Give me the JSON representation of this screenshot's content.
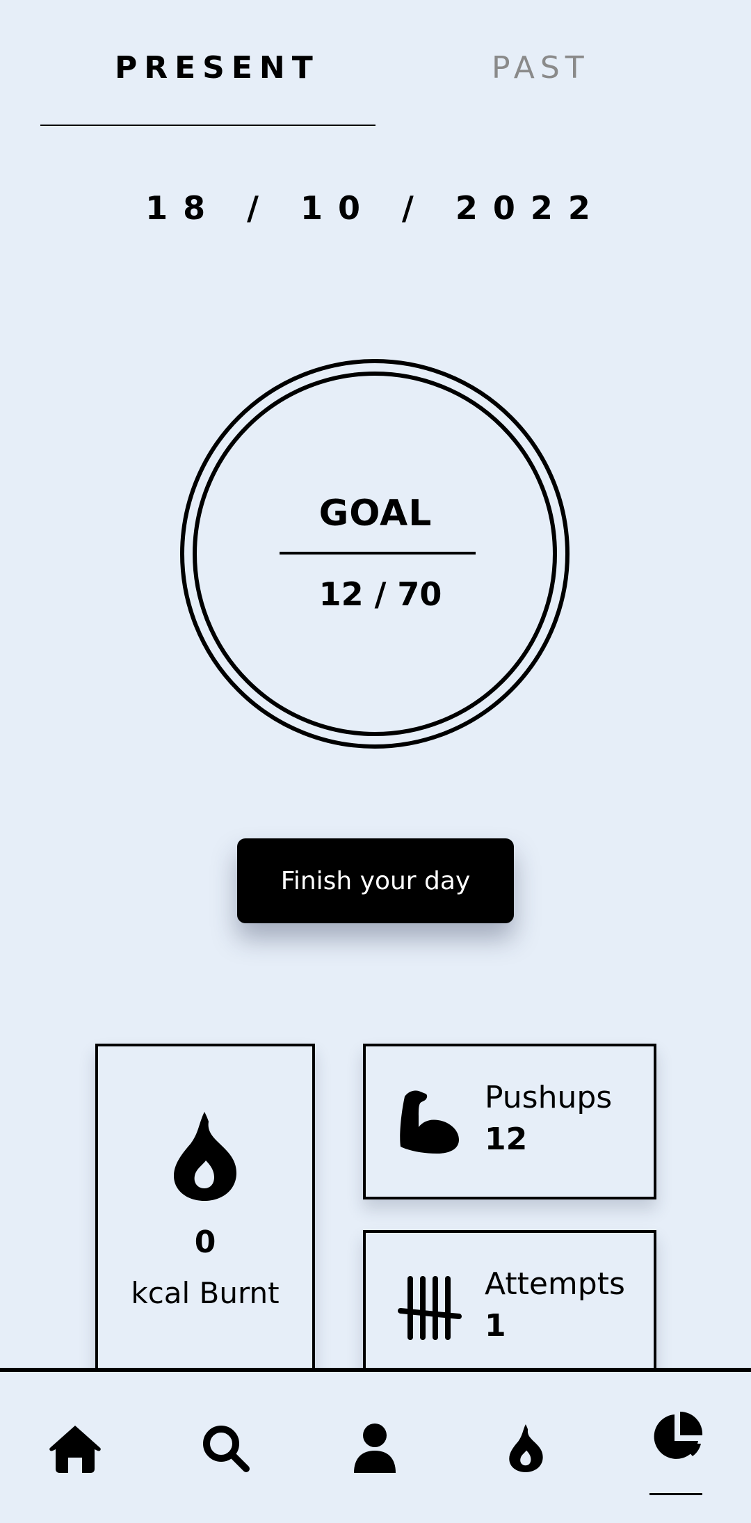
{
  "tabs": {
    "present_label": "PRESENT",
    "past_label": "PAST"
  },
  "date": "18 / 10 / 2022",
  "goal": {
    "title": "GOAL",
    "value": "12 / 70",
    "current": 12,
    "target": 70
  },
  "actions": {
    "finish_label": "Finish your day"
  },
  "stats": {
    "kcal": {
      "value": "0",
      "label": "kcal Burnt",
      "icon": "flame-icon"
    },
    "pushups": {
      "label": "Pushups",
      "value": "12",
      "icon": "flexed-arm-icon"
    },
    "attempts": {
      "label": "Attempts",
      "value": "1",
      "icon": "tally-marks-icon"
    }
  },
  "nav": {
    "items": [
      {
        "icon": "home-icon"
      },
      {
        "icon": "search-icon"
      },
      {
        "icon": "user-icon"
      },
      {
        "icon": "flame-icon"
      },
      {
        "icon": "pie-chart-icon",
        "active": true
      }
    ]
  },
  "colors": {
    "background": "#e6eef8",
    "primary": "#000000",
    "inactive_tab": "#8a8a8a",
    "button_text": "#ffffff"
  }
}
